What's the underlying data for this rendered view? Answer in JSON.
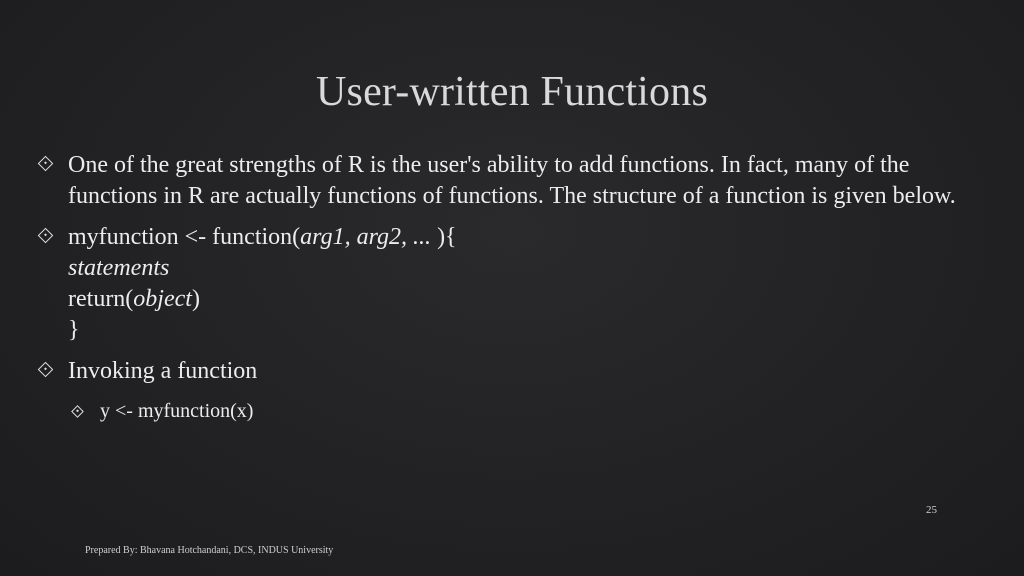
{
  "slide": {
    "title": "User-written Functions",
    "bullets": [
      {
        "text": "One of the great strengths of R is the user's ability to add functions. In fact, many of the functions in R are actually functions of functions. The structure of a function is given below."
      },
      {
        "code": {
          "line1_prefix": "myfunction <- function(",
          "line1_args": "arg1, arg2, ... ",
          "line1_suffix": "){",
          "line2": "statements",
          "line3_prefix": "return(",
          "line3_arg": "object",
          "line3_suffix": ")",
          "line4": "}"
        }
      },
      {
        "text": "Invoking a function",
        "sub": [
          "y <- myfunction(x)"
        ]
      }
    ],
    "page_number": "25",
    "footer": "Prepared By: Bhavana Hotchandani, DCS, INDUS University"
  }
}
